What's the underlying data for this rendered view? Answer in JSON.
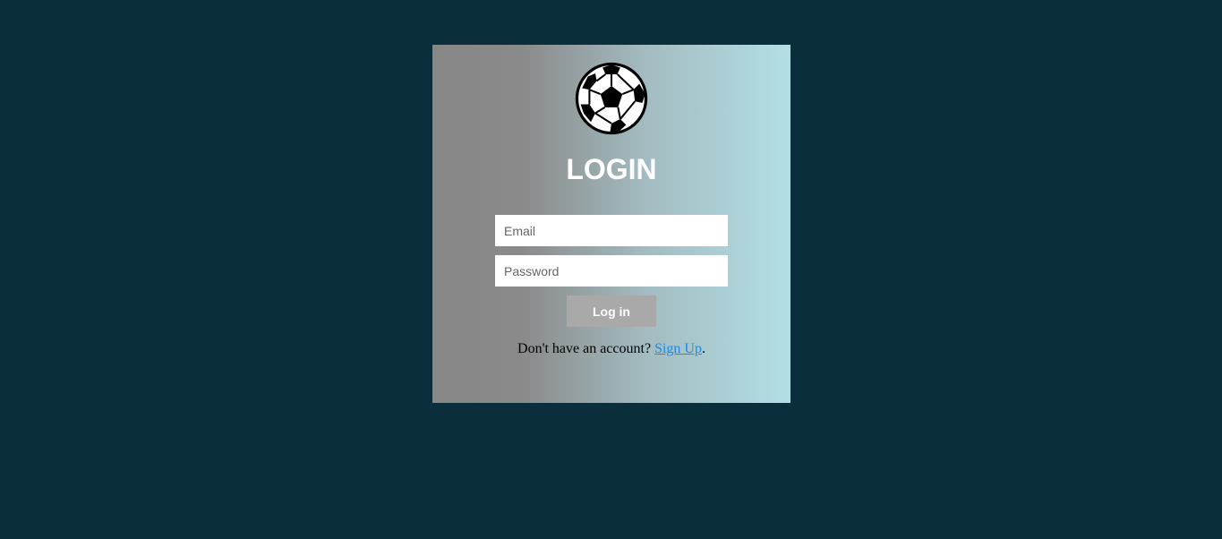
{
  "logo": {
    "icon": "soccer-ball-icon"
  },
  "login": {
    "title": "LOGIN",
    "email_placeholder": "Email",
    "password_placeholder": "Password",
    "submit_label": "Log in"
  },
  "signup": {
    "prompt": "Don't have an account? ",
    "link_label": "Sign Up",
    "suffix": "."
  },
  "colors": {
    "page_background": "#0a2e3b",
    "card_gradient_start": "#878787",
    "card_gradient_end": "#b3dfe5",
    "button_background": "#a9a9a9",
    "link": "#1e88e5"
  }
}
